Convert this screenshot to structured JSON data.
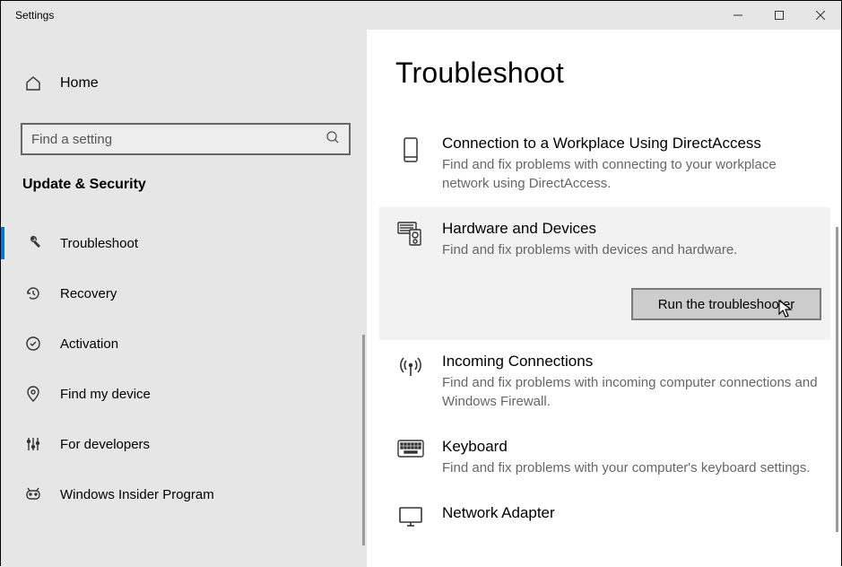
{
  "window": {
    "title": "Settings"
  },
  "sidebar": {
    "home_label": "Home",
    "search_placeholder": "Find a setting",
    "category_label": "Update & Security",
    "items": [
      {
        "label": "Troubleshoot",
        "icon": "wrench",
        "active": true
      },
      {
        "label": "Recovery",
        "icon": "history",
        "active": false
      },
      {
        "label": "Activation",
        "icon": "check-circle",
        "active": false
      },
      {
        "label": "Find my device",
        "icon": "location",
        "active": false
      },
      {
        "label": "For developers",
        "icon": "sliders",
        "active": false
      },
      {
        "label": "Windows Insider Program",
        "icon": "insider",
        "active": false
      }
    ]
  },
  "page": {
    "title": "Troubleshoot",
    "items": [
      {
        "title": "Connection to a Workplace Using DirectAccess",
        "desc": "Find and fix problems with connecting to your workplace network using DirectAccess.",
        "selected": false
      },
      {
        "title": "Hardware and Devices",
        "desc": "Find and fix problems with devices and hardware.",
        "selected": true
      },
      {
        "title": "Incoming Connections",
        "desc": "Find and fix problems with incoming computer connections and Windows Firewall.",
        "selected": false
      },
      {
        "title": "Keyboard",
        "desc": "Find and fix problems with your computer's keyboard settings.",
        "selected": false
      },
      {
        "title": "Network Adapter",
        "desc": "",
        "selected": false
      }
    ],
    "run_button": "Run the troubleshooter"
  }
}
